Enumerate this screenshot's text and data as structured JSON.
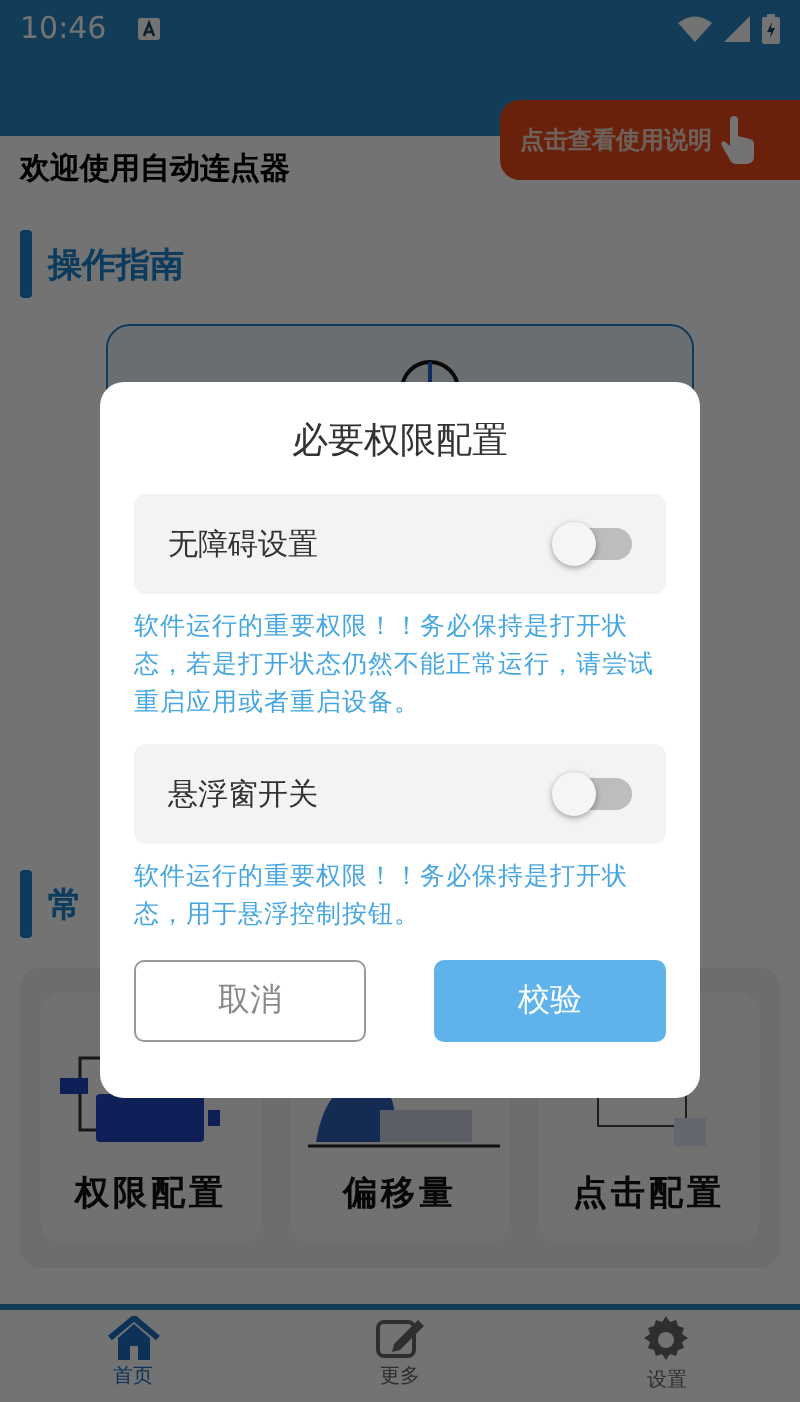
{
  "status_bar": {
    "time": "10:46"
  },
  "header": {
    "title": "欢迎使用自动连点器",
    "help_button": "点击查看使用说明"
  },
  "sections": [
    {
      "title": "操作指南"
    },
    {
      "title": "常"
    }
  ],
  "feature_cards": [
    {
      "label": "权限配置",
      "kind": "monitor"
    },
    {
      "label": "偏移量",
      "kind": "person"
    },
    {
      "label": "点击配置",
      "kind": "form"
    }
  ],
  "bottom_nav": [
    {
      "label": "首页",
      "kind": "home",
      "selected": true
    },
    {
      "label": "更多",
      "kind": "edit",
      "selected": false
    },
    {
      "label": "设置",
      "kind": "settings",
      "selected": false
    }
  ],
  "dialog": {
    "title": "必要权限配置",
    "permissions": [
      {
        "label": "无障碍设置",
        "on": false,
        "note": "软件运行的重要权限！！务必保持是打开状态，若是打开状态仍然不能正常运行，请尝试重启应用或者重启设备。"
      },
      {
        "label": "悬浮窗开关",
        "on": false,
        "note": "软件运行的重要权限！！务必保持是打开状态，用于悬浮控制按钮。"
      }
    ],
    "cancel": "取消",
    "confirm": "校验"
  }
}
